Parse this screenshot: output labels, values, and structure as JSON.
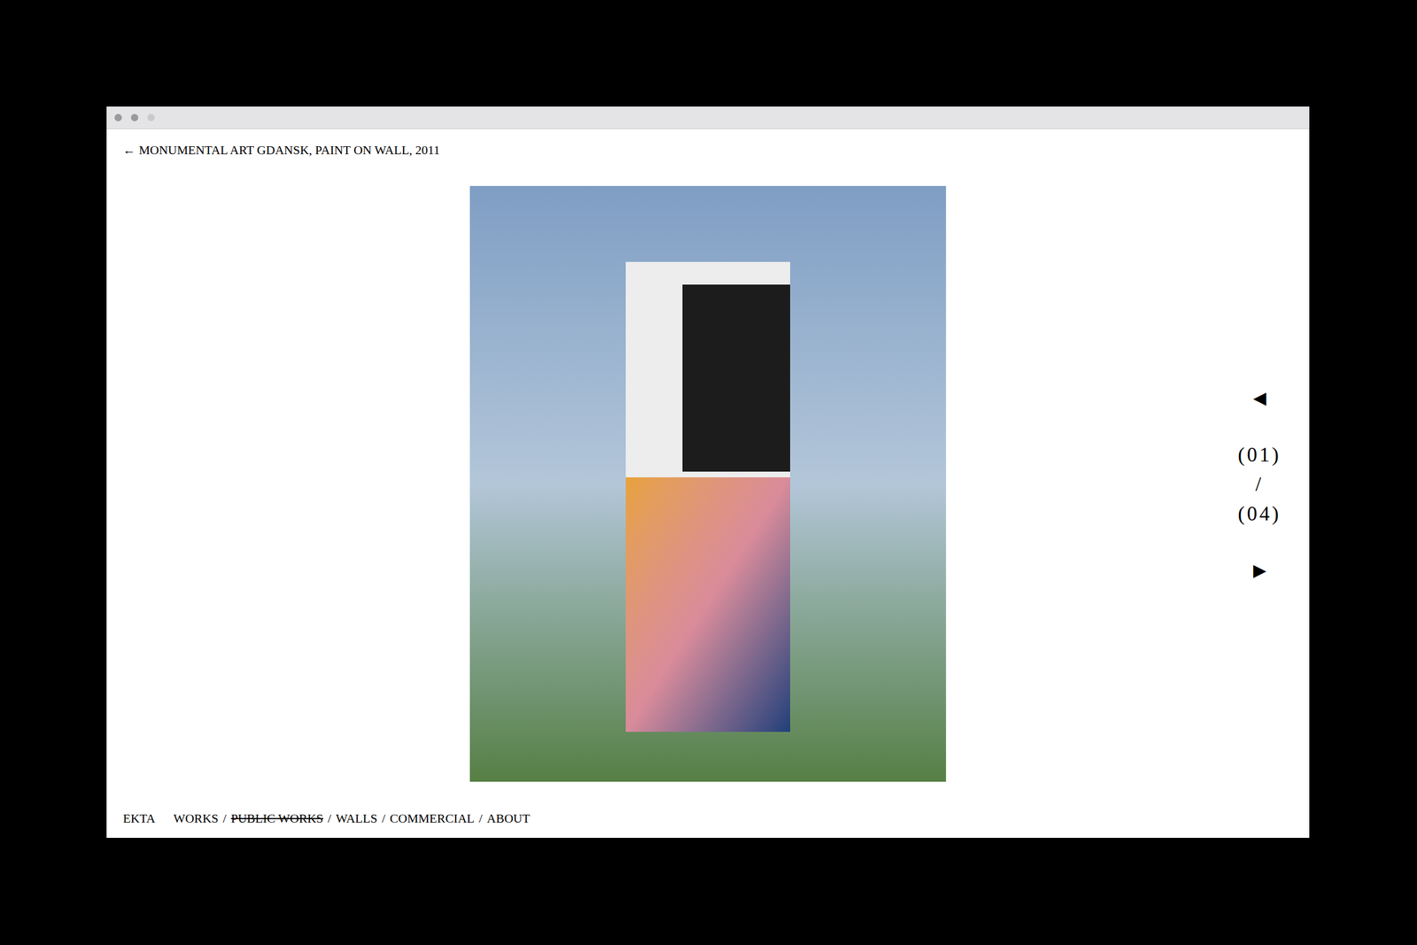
{
  "page": {
    "back_icon": "←",
    "title": "MONUMENTAL ART GDANSK, PAINT ON WALL, 2011"
  },
  "pager": {
    "prev": "◀",
    "current": "(01)",
    "separator": "/",
    "total": "(04)",
    "next": "▶"
  },
  "footer": {
    "brand": "EKTA",
    "separator": "/",
    "nav": [
      {
        "label": "WORKS",
        "selected": false
      },
      {
        "label": "PUBLIC WORKS",
        "selected": true
      },
      {
        "label": "WALLS",
        "selected": false
      },
      {
        "label": "COMMERCIAL",
        "selected": false
      },
      {
        "label": "ABOUT",
        "selected": false
      }
    ]
  }
}
